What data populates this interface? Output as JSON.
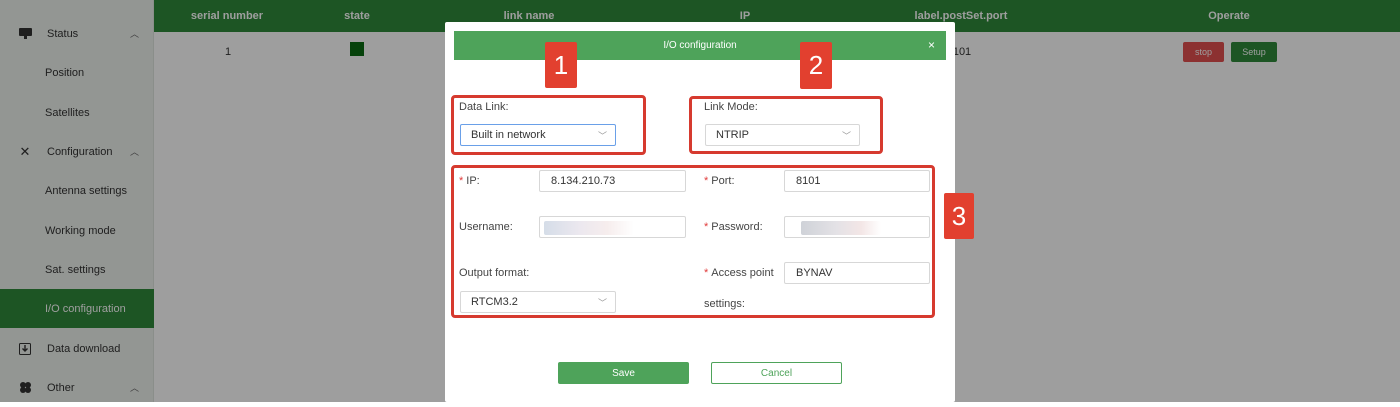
{
  "sidebar": {
    "groups": [
      {
        "label": "Status",
        "icon": "status-icon"
      },
      {
        "label": "Configuration",
        "icon": "wrench-icon"
      },
      {
        "label": "Data download",
        "icon": "download-icon"
      },
      {
        "label": "Other",
        "icon": "clover-icon"
      }
    ],
    "items": [
      {
        "label": "Position"
      },
      {
        "label": "Satellites"
      },
      {
        "label": "Antenna settings"
      },
      {
        "label": "Working mode"
      },
      {
        "label": "Sat. settings"
      },
      {
        "label": "I/O configuration"
      }
    ],
    "active_item": "I/O configuration"
  },
  "table": {
    "headers": [
      "serial number",
      "state",
      "link name",
      "IP",
      "label.postSet.port",
      "Operate"
    ],
    "rows": [
      {
        "serial": "1",
        "state_color": "#0b6b12",
        "port_partial": "101",
        "stop_label": "stop",
        "setup_label": "Setup"
      }
    ]
  },
  "dialog": {
    "title": "I/O configuration",
    "close_glyph": "×",
    "data_link": {
      "label": "Data Link:",
      "value": "Built in network"
    },
    "link_mode": {
      "label": "Link Mode:",
      "value": "NTRIP"
    },
    "ip": {
      "label": "IP:",
      "value": "8.134.210.73",
      "required": true
    },
    "port": {
      "label": "Port:",
      "value": "8101",
      "required": true
    },
    "username": {
      "label": "Username:",
      "value": ""
    },
    "password": {
      "label": "Password:",
      "value": "",
      "required": true
    },
    "output_format": {
      "label": "Output format:",
      "value": "RTCM3.2"
    },
    "access_point": {
      "label_line1": "Access point",
      "label_line2": "settings:",
      "value": "BYNAV",
      "required": true
    },
    "required_mark": "*",
    "save_label": "Save",
    "cancel_label": "Cancel"
  },
  "annotations": [
    "1",
    "2",
    "3"
  ],
  "colors": {
    "brand_green": "#2f8a3b",
    "dialog_green": "#4ea35a",
    "annotation_red": "#d63a2f",
    "stop_red": "#e24f4f"
  }
}
